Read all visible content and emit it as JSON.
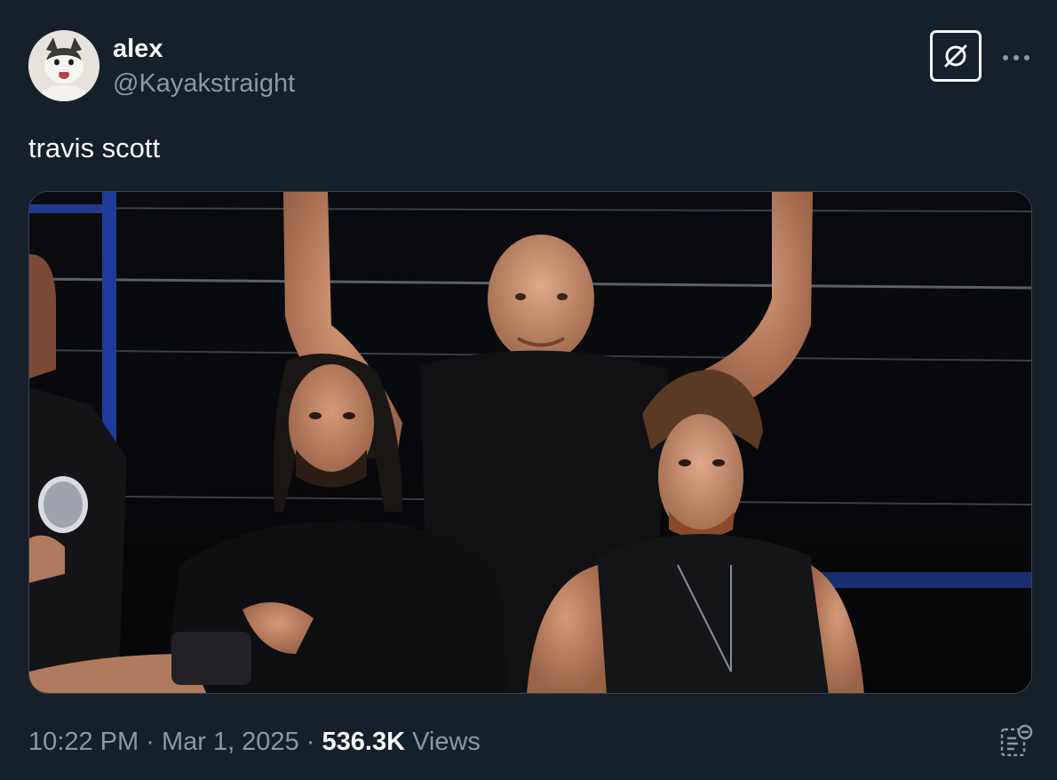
{
  "tweet": {
    "display_name": "alex",
    "handle": "@Kayakstraight",
    "text": "travis scott",
    "time": "10:22 PM",
    "separator": "·",
    "date": "Mar 1, 2025",
    "views_count": "536.3K",
    "views_label": "Views"
  },
  "icons": {
    "grok": "grok-icon",
    "more": "more-icon",
    "analytics": "analytics-icon",
    "avatar": "cat-avatar"
  },
  "colors": {
    "background": "#15202b",
    "primary_text": "#f7f9f9",
    "secondary_text": "#8b98a5",
    "border": "#38444d"
  }
}
